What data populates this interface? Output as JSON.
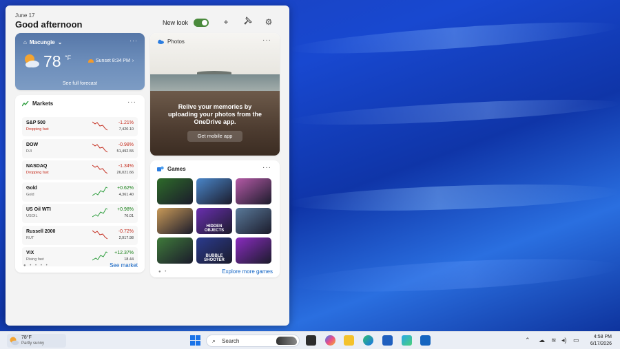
{
  "widgets": {
    "date": "June 17",
    "greeting": "Good afternoon",
    "new_look_label": "New look",
    "new_look_on": true,
    "header_icons": [
      "plus-icon",
      "pin-icon",
      "gear-icon"
    ]
  },
  "weather": {
    "location": "Macungie",
    "temperature": "78",
    "unit": "°F",
    "sunset": "Sunset 8:34 PM",
    "forecast_link": "See full forecast",
    "more": "···"
  },
  "markets": {
    "title": "Markets",
    "more": "···",
    "rows": [
      {
        "symbol": "S&P 500",
        "sub": "Dropping fast",
        "change": "-1.21%",
        "price": "7,420.10",
        "direction": "down",
        "sub_alert": true
      },
      {
        "symbol": "DOW",
        "sub": "DJI",
        "change": "-0.98%",
        "price": "51,492.55",
        "direction": "down",
        "sub_alert": false
      },
      {
        "symbol": "NASDAQ",
        "sub": "Dropping fast",
        "change": "-1.34%",
        "price": "26,021.66",
        "direction": "down",
        "sub_alert": true
      },
      {
        "symbol": "Gold",
        "sub": "Gold",
        "change": "+0.62%",
        "price": "4,361.40",
        "direction": "up",
        "sub_alert": false
      },
      {
        "symbol": "US Oil WTI",
        "sub": "USOIL",
        "change": "+0.98%",
        "price": "76.01",
        "direction": "up",
        "sub_alert": false
      },
      {
        "symbol": "Russell 2000",
        "sub": "RUT",
        "change": "-0.72%",
        "price": "2,917.98",
        "direction": "down",
        "sub_alert": false
      },
      {
        "symbol": "VIX",
        "sub": "Rising fast",
        "change": "+12.37%",
        "price": "18.44",
        "direction": "up",
        "sub_alert": false
      }
    ],
    "see_more": "See market"
  },
  "photos": {
    "title": "Photos",
    "more": "···",
    "message": "Relive your memories by uploading your photos from the OneDrive app.",
    "button": "Get mobile app"
  },
  "games": {
    "title": "Games",
    "more": "···",
    "tiles": [
      {
        "name": "Spider Solitaire",
        "label": "",
        "color": "#2e6b2a"
      },
      {
        "name": "Shark game",
        "label": "",
        "color": "#4a86c9"
      },
      {
        "name": "Pinball",
        "label": "",
        "color": "#b45aa6"
      },
      {
        "name": "Hidden object",
        "label": "",
        "color": "#c99a58"
      },
      {
        "name": "Hidden Objects",
        "label": "HIDDEN OBJECTS",
        "color": "#6a2fb0"
      },
      {
        "name": "Racing",
        "label": "",
        "color": "#5a7a9a"
      },
      {
        "name": "Solitaire",
        "label": "",
        "color": "#3f7a3a"
      },
      {
        "name": "Bubble Shooter",
        "label": "BUBBLE SHOOTER",
        "color": "#2b3b8f"
      },
      {
        "name": "Sports car",
        "label": "",
        "color": "#8a2cc0"
      }
    ],
    "see_more": "Explore more games"
  },
  "taskbar": {
    "weather_temp": "78°F",
    "weather_desc": "Partly sunny",
    "search_placeholder": "Search",
    "time": "4:58 PM",
    "date": "6/17/2026",
    "app_icons": [
      "file-explorer-icon",
      "copilot-icon",
      "folder-icon",
      "edge-icon",
      "store-icon",
      "photos-icon",
      "outlook-icon"
    ],
    "tray_icons": [
      "chevron-up-icon",
      "cloud-icon",
      "wifi-icon",
      "volume-icon",
      "battery-icon"
    ]
  }
}
